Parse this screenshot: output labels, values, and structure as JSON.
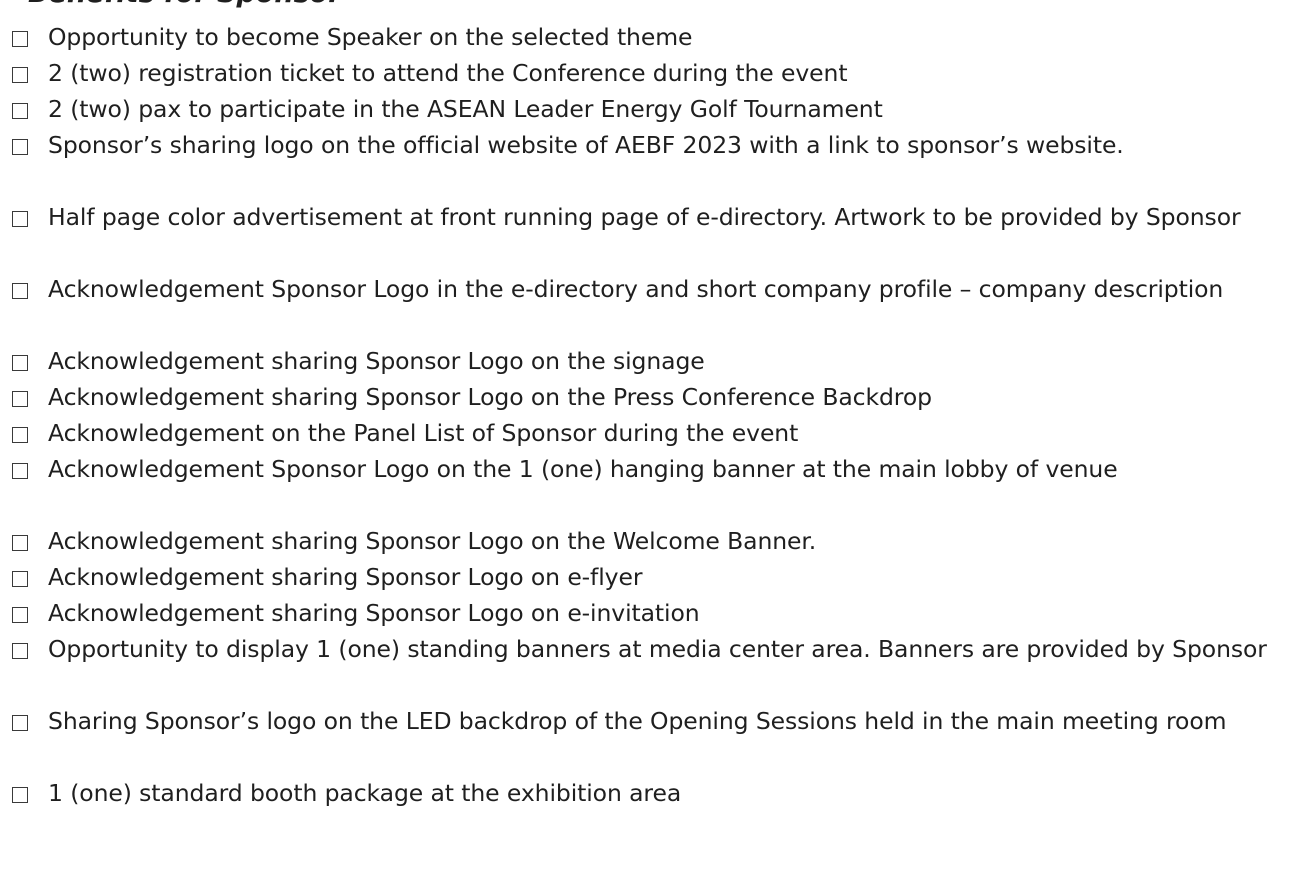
{
  "document": {
    "heading_fragment": "Benefits for Sponsor",
    "checkbox_icon": "empty-square-checkbox-icon",
    "items": [
      {
        "text": "Opportunity to become Speaker on the selected theme"
      },
      {
        "text": "2 (two) registration ticket to attend the Conference during the event"
      },
      {
        "text": "2 (two) pax to participate in the ASEAN Leader Energy Golf Tournament"
      },
      {
        "text": "Sponsor’s sharing logo on the official website of AEBF 2023 with a link to sponsor’s website."
      },
      {
        "text": "Half page color advertisement at front running page of e-directory. Artwork to be provided by Sponsor"
      },
      {
        "text": "Acknowledgement Sponsor Logo in the e-directory and short company profile – company description"
      },
      {
        "text": "Acknowledgement sharing Sponsor Logo on the signage"
      },
      {
        "text": "Acknowledgement sharing Sponsor Logo on the Press Conference Backdrop"
      },
      {
        "text": "Acknowledgement on the Panel List of Sponsor during the event"
      },
      {
        "text": "Acknowledgement Sponsor Logo on the 1 (one) hanging banner at the main lobby of venue"
      },
      {
        "text": "Acknowledgement sharing Sponsor Logo on the Welcome Banner."
      },
      {
        "text": "Acknowledgement sharing Sponsor Logo on e-flyer"
      },
      {
        "text": "Acknowledgement sharing Sponsor Logo on e-invitation"
      },
      {
        "text": "Opportunity to display 1 (one) standing banners at media center area. Banners are provided by Sponsor"
      },
      {
        "text": "Sharing Sponsor’s logo on the LED backdrop of the Opening Sessions held in the main meeting room"
      },
      {
        "text": "1 (one) standard booth package at the exhibition area"
      }
    ]
  }
}
